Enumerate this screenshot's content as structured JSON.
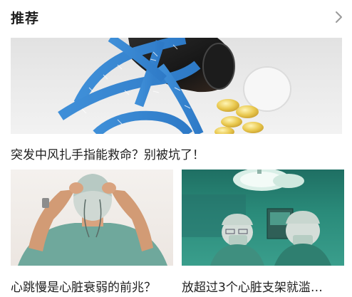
{
  "section": {
    "title": "推荐",
    "more_icon": "chevron-right-icon"
  },
  "articles": [
    {
      "title": "突发中风扎手指能救命？别被坑了！",
      "image": "measuring-tape-and-pills"
    },
    {
      "title": "心跳慢是心脏衰弱的前兆？",
      "image": "surgeon-tying-mask"
    },
    {
      "title": "放超过3个心脏支架就滥…",
      "image": "operating-room-surgeons"
    }
  ]
}
